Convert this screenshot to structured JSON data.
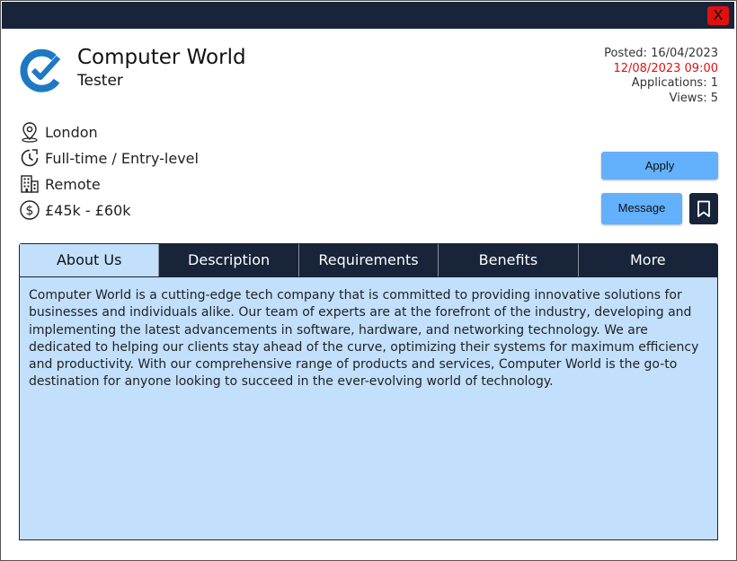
{
  "window": {
    "close_label": "X"
  },
  "job": {
    "company": "Computer World",
    "role": "Tester",
    "posted": "Posted: 16/04/2023",
    "deadline": "12/08/2023 09:00",
    "applications": "Applications: 1",
    "views": "Views: 5",
    "location": "London",
    "type": "Full-time / Entry-level",
    "workplace": "Remote",
    "salary": "£45k - £60k"
  },
  "icons": [
    "logo-check-icon",
    "location-pin-icon",
    "clock-icon",
    "building-icon",
    "dollar-icon",
    "bookmark-icon"
  ],
  "actions": {
    "apply_label": "Apply",
    "message_label": "Message"
  },
  "tabs": [
    {
      "label": "About Us",
      "active": true
    },
    {
      "label": "Description",
      "active": false
    },
    {
      "label": "Requirements",
      "active": false
    },
    {
      "label": "Benefits",
      "active": false
    },
    {
      "label": "More",
      "active": false
    }
  ],
  "about": "Computer World is a cutting-edge tech company that is committed to providing innovative solutions for businesses and individuals alike. Our team of experts are at the forefront of the industry, developing and implementing the latest advancements in software, hardware, and networking technology. We are dedicated to helping our clients stay ahead of the curve, optimizing their systems for maximum efficiency and productivity. With our comprehensive range of products and services, Computer World is the go-to destination for anyone looking to succeed in the ever-evolving world of technology.",
  "colors": {
    "navy": "#17243a",
    "accent": "#63b0fc",
    "panel": "#c2e0fc",
    "red": "#e01010"
  }
}
